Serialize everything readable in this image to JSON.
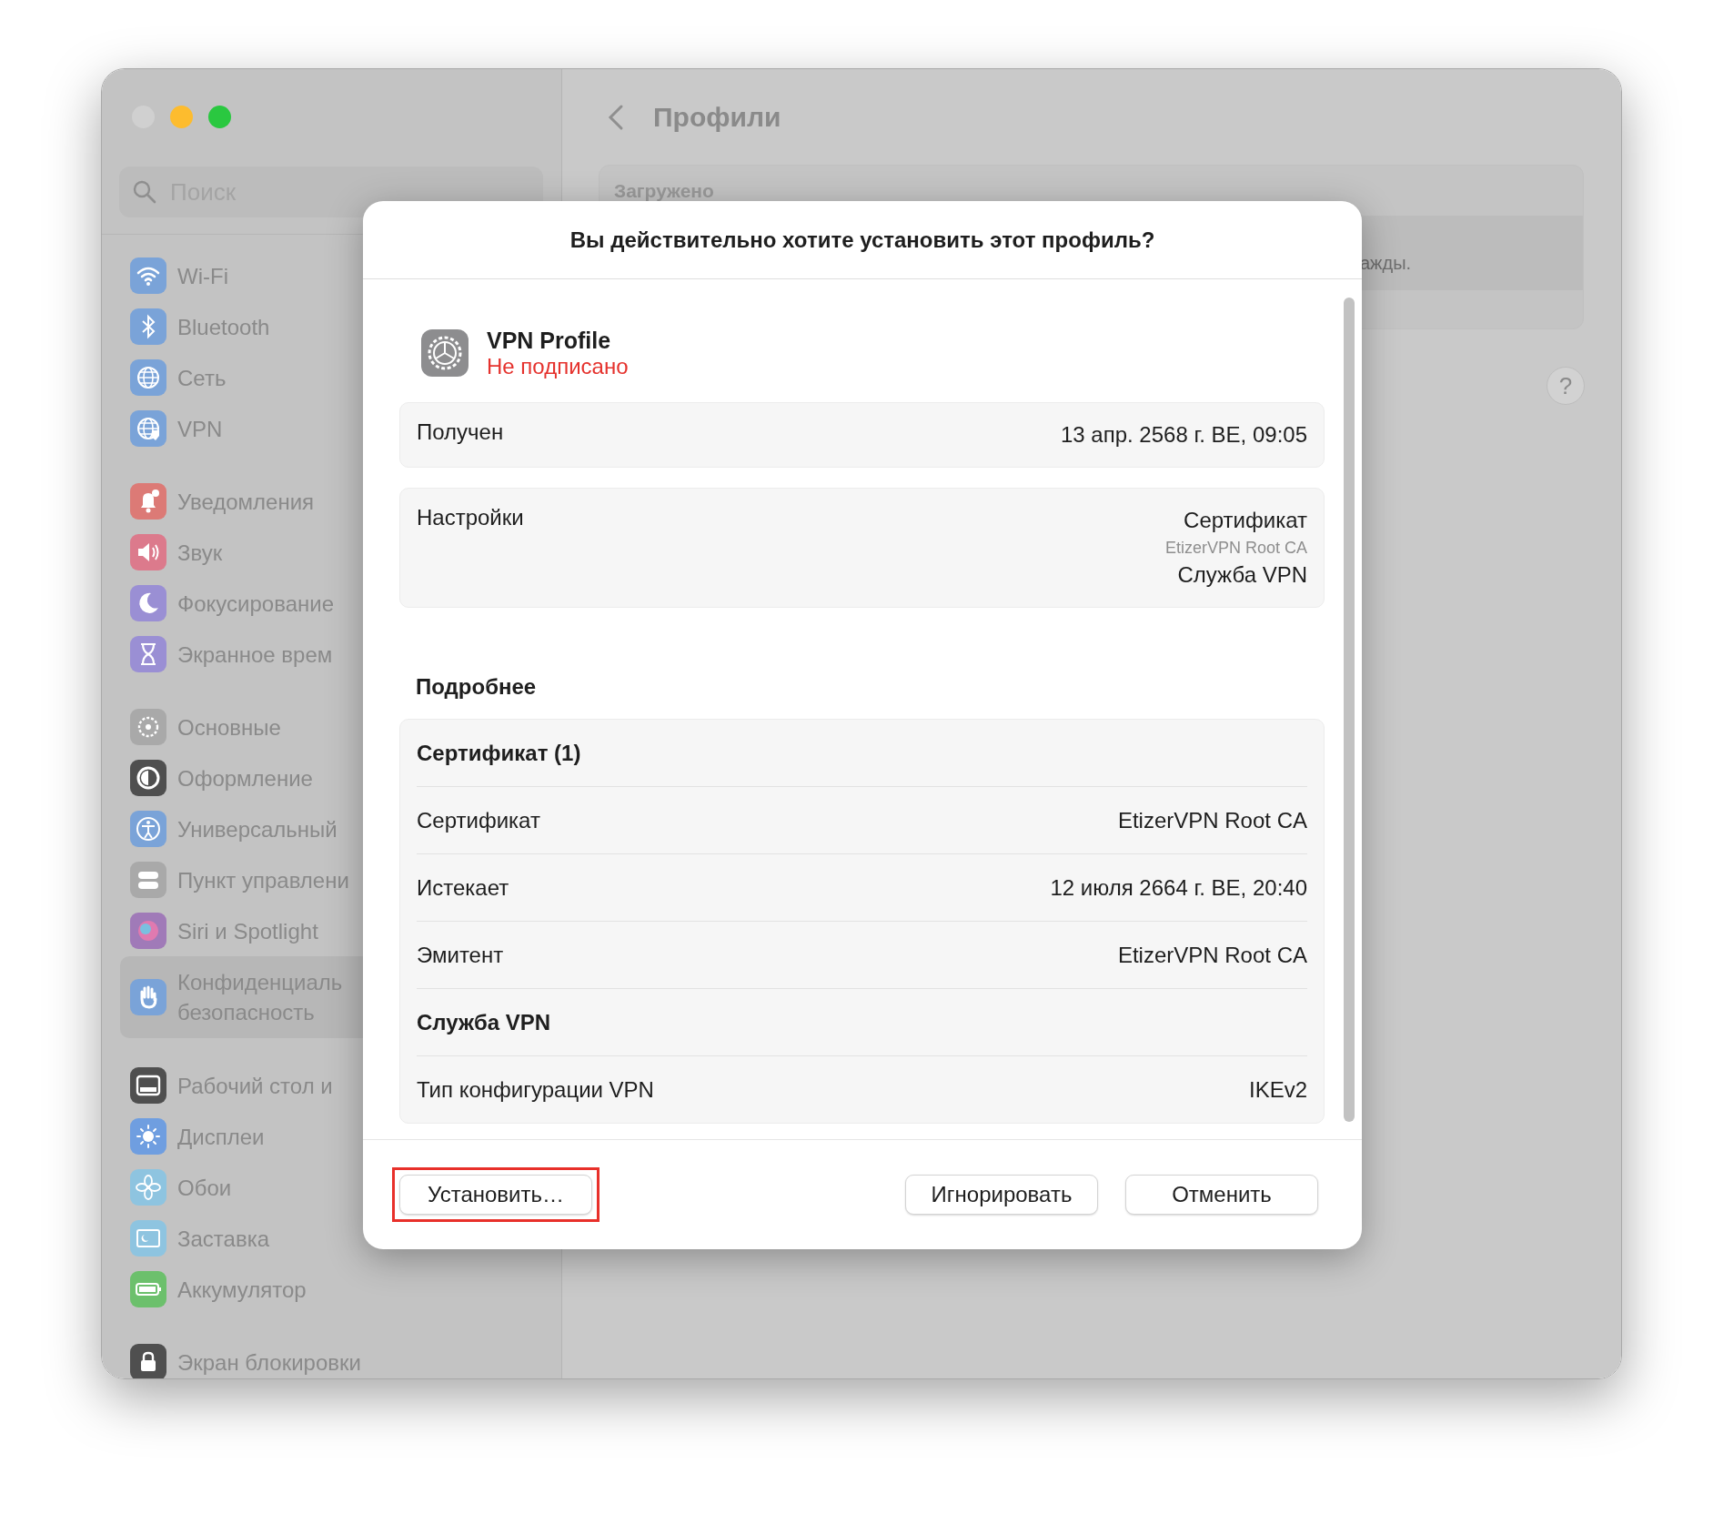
{
  "window": {
    "traffic_lights": [
      {
        "color": "#d0d0d0"
      },
      {
        "color": "#fdbc2e"
      },
      {
        "color": "#2ac840"
      }
    ],
    "sidebar": {
      "search": {
        "placeholder": "Поиск"
      },
      "sections": [
        {
          "items": [
            {
              "label": "Wi-Fi",
              "color": "#7aa3d8",
              "selected": false
            },
            {
              "label": "Bluetooth",
              "color": "#7aa3d8",
              "selected": false
            },
            {
              "label": "Сеть",
              "color": "#7aa3d8",
              "selected": false
            },
            {
              "label": "VPN",
              "color": "#7aa3d8",
              "selected": false
            }
          ]
        },
        {
          "items": [
            {
              "label": "Уведомления",
              "color": "#dc7a76",
              "selected": false
            },
            {
              "label": "Звук",
              "color": "#dc7a8c",
              "selected": false
            },
            {
              "label": "Фокусирование",
              "color": "#9a8fd4",
              "selected": false
            },
            {
              "label": "Экранное врем",
              "color": "#9a8fd4",
              "selected": false
            }
          ]
        },
        {
          "items": [
            {
              "label": "Основные",
              "color": "#a9a9a9",
              "selected": false
            },
            {
              "label": "Оформление",
              "color": "#4f4f4f",
              "selected": false
            },
            {
              "label": "Универсальный",
              "color": "#7aa3d8",
              "selected": false
            },
            {
              "label": "Пункт управлени",
              "color": "#a9a9a9",
              "selected": false
            },
            {
              "label": "Siri и Spotlight",
              "color": "#a07ab8",
              "selected": false
            },
            {
              "label": "Конфиденциаль",
              "second_line": "безопасность",
              "color": "#7aa3d8",
              "selected": true
            }
          ]
        },
        {
          "items": [
            {
              "label": "Рабочий стол и",
              "color": "#4f4f4f",
              "selected": false
            },
            {
              "label": "Дисплеи",
              "color": "#6f9ee0",
              "selected": false
            },
            {
              "label": "Обои",
              "color": "#8ec4e0",
              "selected": false
            },
            {
              "label": "Заставка",
              "color": "#8ec4e0",
              "selected": false
            },
            {
              "label": "Аккумулятор",
              "color": "#6cc06c",
              "selected": false
            }
          ]
        },
        {
          "items": [
            {
              "label": "Экран блокировки",
              "color": "#4f4f4f",
              "selected": false
            }
          ]
        }
      ]
    },
    "pane": {
      "title": "Профили",
      "group_header": "Загружено",
      "row_fragment": "ажды.",
      "help": "?"
    }
  },
  "dialog": {
    "title": "Вы действительно хотите установить этот профиль?",
    "profile": {
      "name": "VPN Profile",
      "status": "Не подписано",
      "signed": false
    },
    "summary": [
      {
        "label": "Получен",
        "values": [
          {
            "text": "13 апр. 2568 г. BE, 09:05",
            "kind": "main"
          }
        ]
      },
      {
        "label": "Настройки",
        "values": [
          {
            "text": "Сертификат",
            "kind": "main"
          },
          {
            "text": "EtizerVPN Root CA",
            "kind": "detail"
          },
          {
            "text": "Служба VPN",
            "kind": "main"
          }
        ]
      }
    ],
    "details_heading": "Подробнее",
    "details": [
      {
        "kind": "header",
        "label": "Сертификат (1)"
      },
      {
        "kind": "row",
        "label": "Сертификат",
        "value": "EtizerVPN Root CA"
      },
      {
        "kind": "row",
        "label": "Истекает",
        "value": "12 июля 2664 г. BE, 20:40"
      },
      {
        "kind": "row",
        "label": "Эмитент",
        "value": "EtizerVPN Root CA"
      },
      {
        "kind": "header",
        "label": "Служба VPN"
      },
      {
        "kind": "row",
        "label": "Тип конфигурации VPN",
        "value": "IKEv2"
      }
    ],
    "buttons": [
      {
        "label": "Установить…",
        "highlighted": true
      },
      {
        "label": "Игнорировать",
        "highlighted": false
      },
      {
        "label": "Отменить",
        "highlighted": false
      }
    ]
  }
}
